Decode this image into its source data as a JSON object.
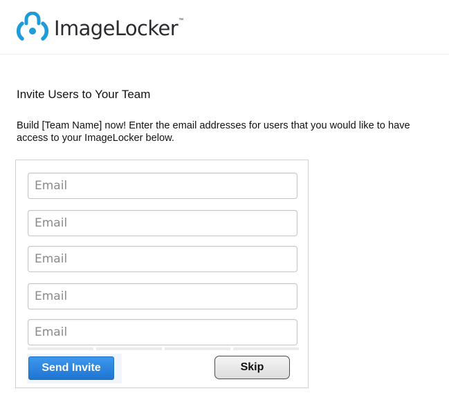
{
  "brand": {
    "name": "ImageLocker",
    "trademark": "™",
    "logo_icon": "padlock-lens-icon",
    "accent_color": "#1f9bd7"
  },
  "invite": {
    "title": "Invite Users to Your Team",
    "intro": "Build [Team Name] now!  Enter the email addresses for users that you would like to have access to your ImageLocker below.",
    "email_fields": [
      {
        "placeholder": "Email",
        "value": ""
      },
      {
        "placeholder": "Email",
        "value": ""
      },
      {
        "placeholder": "Email",
        "value": ""
      },
      {
        "placeholder": "Email",
        "value": ""
      },
      {
        "placeholder": "Email",
        "value": ""
      }
    ],
    "send_label": "Send Invite",
    "skip_label": "Skip"
  },
  "colors": {
    "send_button": "#2a84dd",
    "skip_button": "#e2e2e2"
  }
}
